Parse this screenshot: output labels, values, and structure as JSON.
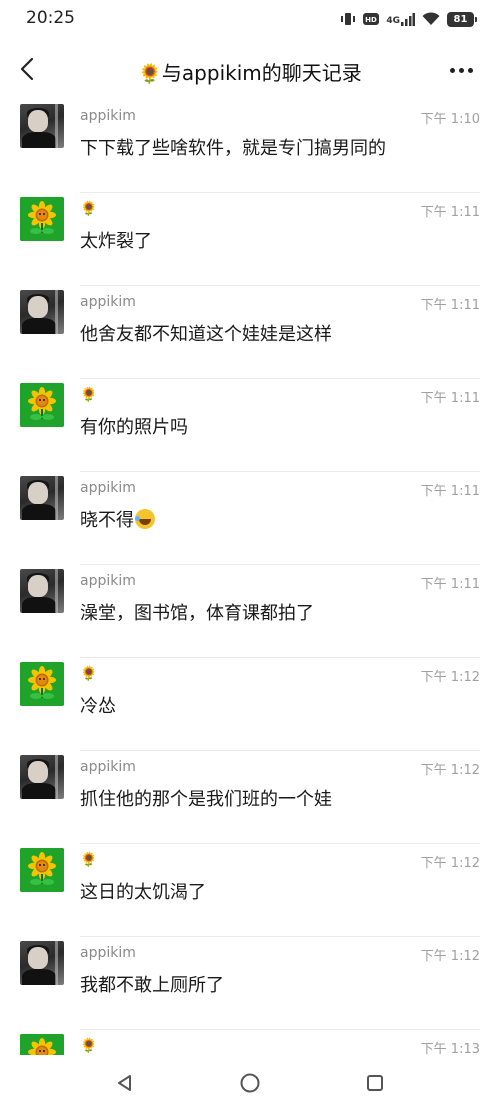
{
  "status_bar": {
    "time": "20:25",
    "network_label": "4G",
    "battery_level": "81"
  },
  "header": {
    "title_emoji": "🌻",
    "title": "与appikim的聊天记录"
  },
  "colors": {
    "background": "#ffffff",
    "name_text": "#8a8a8a",
    "time_text": "#a0a0a0",
    "plant_avatar": "#1fa32a"
  },
  "messages": [
    {
      "sender": "appikim",
      "avatar": "person",
      "time": "下午 1:10",
      "text": "下下载了些啥软件，就是专门搞男同的"
    },
    {
      "sender": "🌻",
      "avatar": "plant",
      "time": "下午 1:11",
      "text": "太炸裂了"
    },
    {
      "sender": "appikim",
      "avatar": "person",
      "time": "下午 1:11",
      "text": "他舍友都不知道这个娃娃是这样"
    },
    {
      "sender": "🌻",
      "avatar": "plant",
      "time": "下午 1:11",
      "text": "有你的照片吗"
    },
    {
      "sender": "appikim",
      "avatar": "person",
      "time": "下午 1:11",
      "text": "晓不得",
      "emoji": "laugh-cry"
    },
    {
      "sender": "appikim",
      "avatar": "person",
      "time": "下午 1:11",
      "text": "澡堂，图书馆，体育课都拍了"
    },
    {
      "sender": "🌻",
      "avatar": "plant",
      "time": "下午 1:12",
      "text": "冷怂"
    },
    {
      "sender": "appikim",
      "avatar": "person",
      "time": "下午 1:12",
      "text": "抓住他的那个是我们班的一个娃"
    },
    {
      "sender": "🌻",
      "avatar": "plant",
      "time": "下午 1:12",
      "text": "这日的太饥渴了"
    },
    {
      "sender": "appikim",
      "avatar": "person",
      "time": "下午 1:12",
      "text": "我都不敢上厕所了"
    },
    {
      "sender": "🌻",
      "avatar": "plant",
      "time": "下午 1:13",
      "text": ""
    }
  ],
  "navbar": {
    "back_icon": "triangle-back-icon",
    "home_icon": "circle-home-icon",
    "recents_icon": "square-recents-icon"
  }
}
